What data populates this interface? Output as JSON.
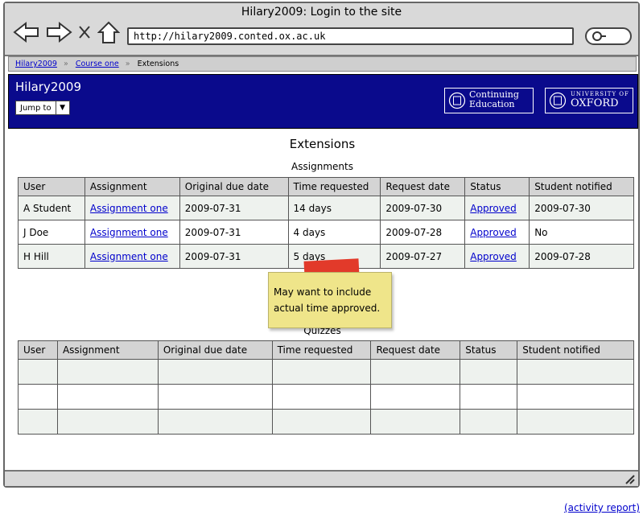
{
  "window": {
    "title": "Hilary2009: Login to the site",
    "url": "http://hilary2009.conted.ox.ac.uk"
  },
  "breadcrumb": {
    "items": [
      "Hilary2009",
      "Course one",
      "Extensions"
    ]
  },
  "site": {
    "name": "Hilary2009",
    "jump_label": "Jump to",
    "logos": {
      "conted_line1": "Continuing",
      "conted_line2": "Education",
      "oxford_line1": "UNIVERSITY OF",
      "oxford_line2": "OXFORD"
    }
  },
  "page": {
    "title": "Extensions"
  },
  "assignments": {
    "heading": "Assignments",
    "columns": [
      "User",
      "Assignment",
      "Original due date",
      "Time requested",
      "Request date",
      "Status",
      "Student notified"
    ],
    "rows": [
      [
        "A Student",
        "Assignment one",
        "2009-07-31",
        "14 days",
        "2009-07-30",
        "Approved",
        "2009-07-30"
      ],
      [
        "J Doe",
        "Assignment one",
        "2009-07-31",
        "4 days",
        "2009-07-28",
        "Approved",
        "No"
      ],
      [
        "H Hill",
        "Assignment one",
        "2009-07-31",
        "5 days",
        "2009-07-27",
        "Approved",
        "2009-07-28"
      ]
    ]
  },
  "quizzes": {
    "heading": "Quizzes",
    "columns": [
      "User",
      "Assignment",
      "Original due date",
      "Time requested",
      "Request date",
      "Status",
      "Student notified"
    ]
  },
  "note": {
    "line1": "May want to include",
    "line2": "actual time approved."
  },
  "footer": {
    "activity_link": "(activity report)"
  },
  "colors": {
    "header_bg": "#0a0a8c",
    "link": "#0000cc",
    "note_bg": "#efe58a",
    "tape": "#e23a2a"
  }
}
